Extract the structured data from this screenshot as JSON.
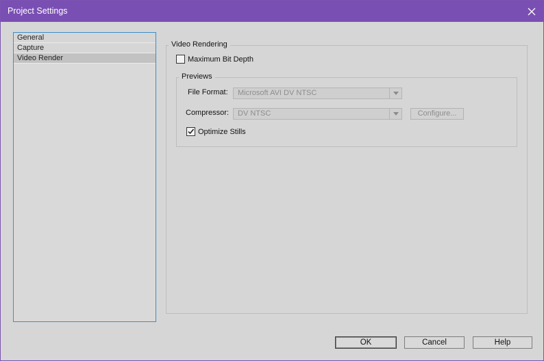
{
  "window": {
    "title": "Project Settings"
  },
  "nav": {
    "items": [
      {
        "label": "General",
        "selected": false
      },
      {
        "label": "Capture",
        "selected": false
      },
      {
        "label": "Video Render",
        "selected": true
      }
    ]
  },
  "video_rendering": {
    "group_label": "Video Rendering",
    "max_bit_depth_label": "Maximum Bit Depth",
    "max_bit_depth_checked": false
  },
  "previews": {
    "group_label": "Previews",
    "file_format_label": "File Format:",
    "file_format_value": "Microsoft AVI DV NTSC",
    "compressor_label": "Compressor:",
    "compressor_value": "DV NTSC",
    "configure_label": "Configure...",
    "optimize_stills_label": "Optimize Stills",
    "optimize_stills_checked": true
  },
  "footer": {
    "ok_label": "OK",
    "cancel_label": "Cancel",
    "help_label": "Help"
  },
  "colors": {
    "titlebar": "#7a4fb3",
    "dialog_bg": "#d6d6d6",
    "list_focus_border": "#3a8ec6"
  }
}
